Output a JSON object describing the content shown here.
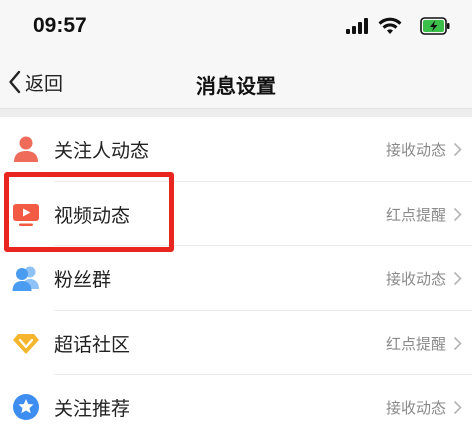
{
  "status": {
    "time": "09:57"
  },
  "nav": {
    "back_label": "返回",
    "title": "消息设置"
  },
  "items": [
    {
      "label": "关注人动态",
      "value": "接收动态",
      "icon": "person-icon"
    },
    {
      "label": "视频动态",
      "value": "红点提醒",
      "icon": "video-icon"
    },
    {
      "label": "粉丝群",
      "value": "接收动态",
      "icon": "group-icon"
    },
    {
      "label": "超话社区",
      "value": "红点提醒",
      "icon": "diamond-icon"
    },
    {
      "label": "关注推荐",
      "value": "接收动态",
      "icon": "star-icon"
    }
  ],
  "colors": {
    "highlight": "#e8251f",
    "battery": "#3bbf4a",
    "person_icon": "#f06c5a",
    "video_icon": "#f25a43",
    "group_icon": "#4a9cf0",
    "diamond_icon": "#f5b62e",
    "star_icon": "#3d8ef0"
  }
}
